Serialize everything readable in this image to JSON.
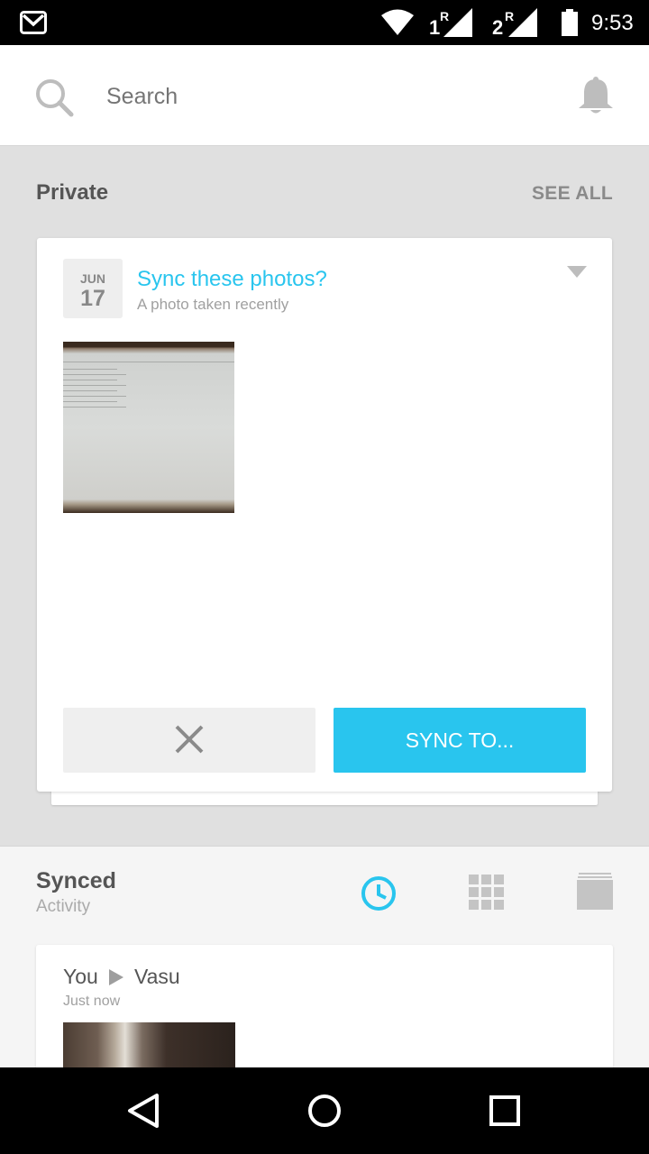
{
  "status_bar": {
    "time": "9:53",
    "sim1": "1",
    "sim2": "2",
    "roaming": "R"
  },
  "search": {
    "placeholder": "Search"
  },
  "private": {
    "title": "Private",
    "see_all": "SEE ALL"
  },
  "sync_card": {
    "month": "JUN",
    "day": "17",
    "title": "Sync these photos?",
    "subtitle": "A photo taken recently",
    "sync_button": "SYNC TO..."
  },
  "synced": {
    "title": "Synced",
    "subtitle": "Activity"
  },
  "activity": {
    "from": "You",
    "to": "Vasu",
    "time": "Just now"
  },
  "colors": {
    "accent": "#29c5ee",
    "background": "#e0e0e0",
    "text": "#555555"
  }
}
